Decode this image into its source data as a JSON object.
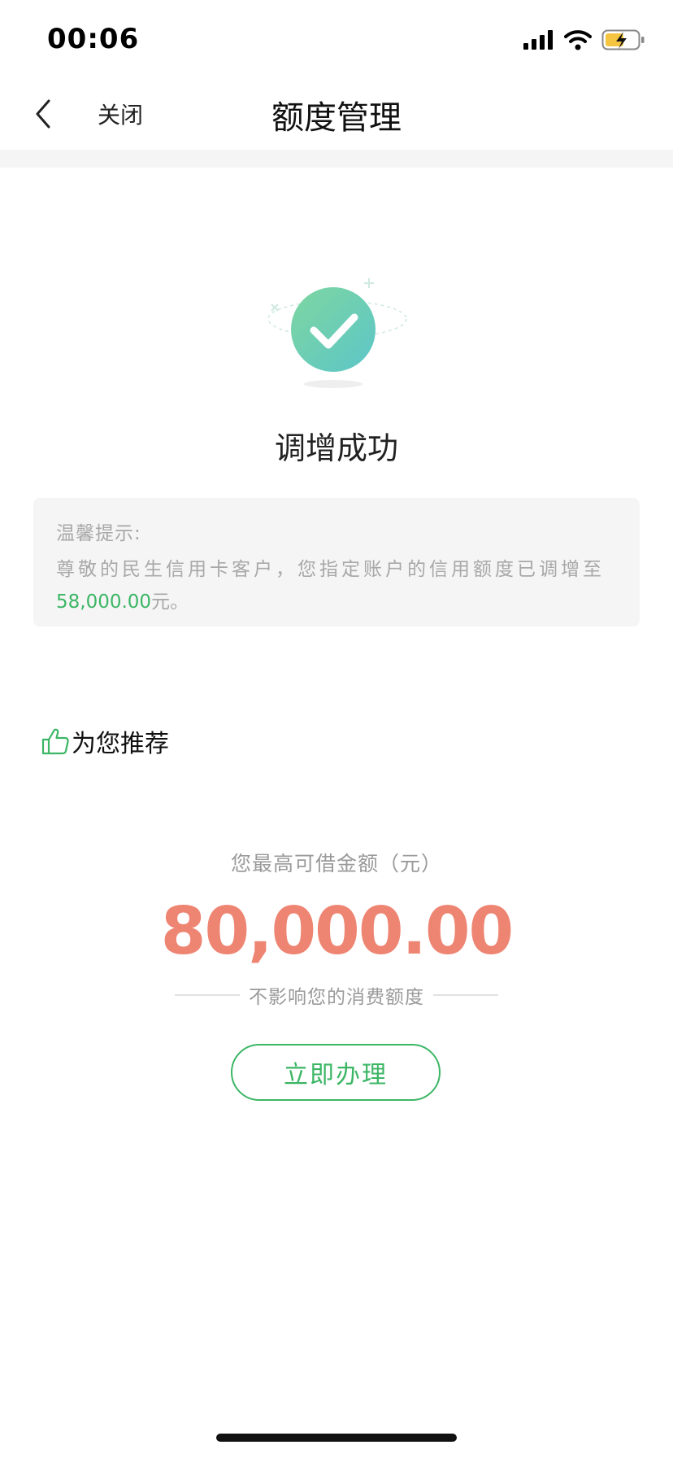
{
  "status_bar": {
    "time": "00:06",
    "icons": [
      "signal-icon",
      "wifi-icon",
      "battery-charging-icon"
    ],
    "battery_color": "#f5c542"
  },
  "nav": {
    "back_icon": "chevron-left-icon",
    "close_label": "关闭",
    "title": "额度管理"
  },
  "result": {
    "icon": "check-circle-icon",
    "title": "调增成功"
  },
  "tip": {
    "label": "温馨提示:",
    "body_prefix": "尊敬的民生信用卡客户，您指定账户的信用额度已调增至",
    "amount": "58,000.00",
    "body_suffix": "元。"
  },
  "recommend": {
    "icon": "thumbs-up-icon",
    "title": "为您推荐"
  },
  "loan_offer": {
    "label": "您最高可借金额（元）",
    "amount": "80,000.00",
    "note": "不影响您的消费额度",
    "button_label": "立即办理"
  },
  "colors": {
    "accent_green": "#3cb665",
    "amount_orange": "#ee8472",
    "check_gradient_start": "#7ed6a0",
    "check_gradient_end": "#5cc6c9"
  }
}
